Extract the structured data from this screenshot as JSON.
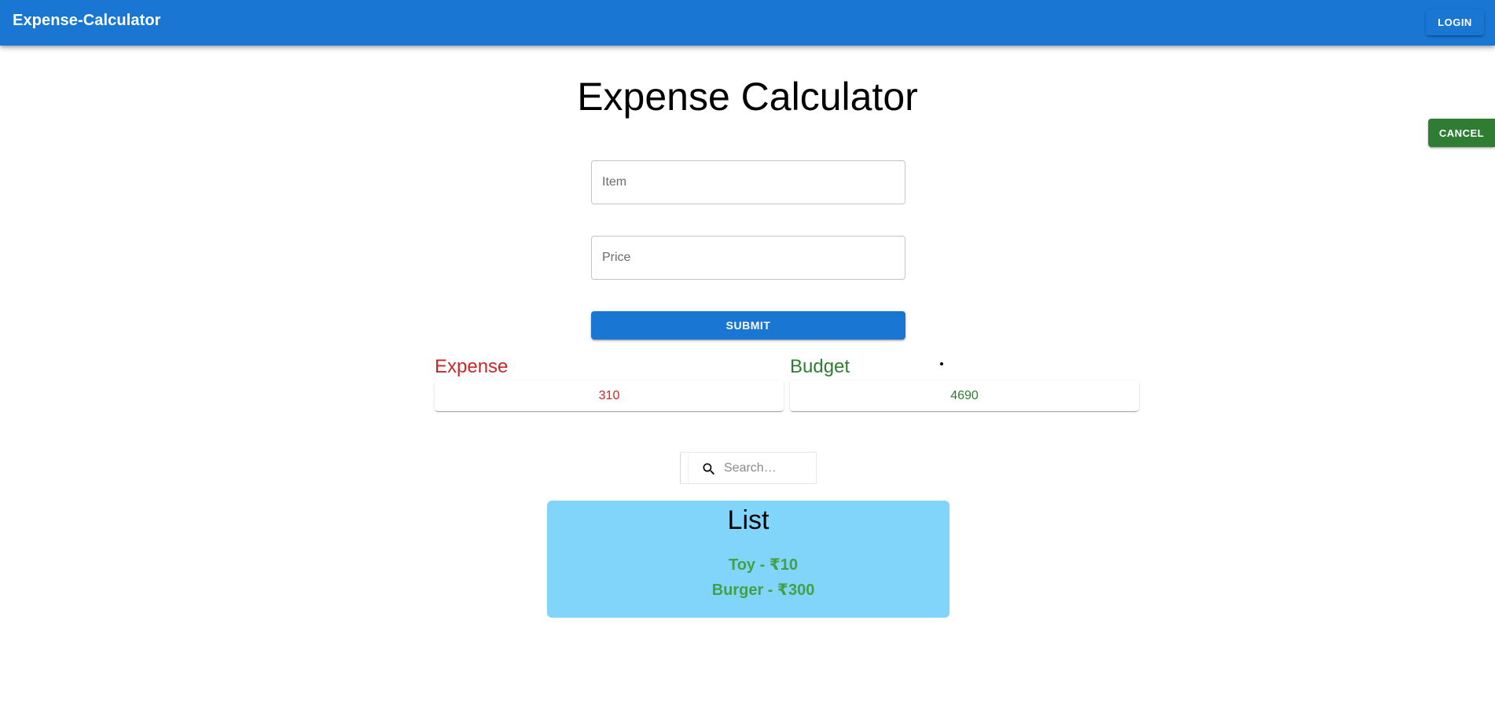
{
  "appbar": {
    "title": "Expense-Calculator",
    "login_label": "LOGIN",
    "color": "#1976d2"
  },
  "main": {
    "title": "Expense Calculator",
    "cancel_label": "CANCEL",
    "item_placeholder": "Item",
    "price_placeholder": "Price",
    "submit_label": "SUBMIT"
  },
  "stats": {
    "expense": {
      "label": "Expense",
      "value": "310",
      "color": "#c62828"
    },
    "budget": {
      "label": "Budget",
      "value": "4690",
      "color": "#2e7d32"
    }
  },
  "search": {
    "placeholder": "Search…",
    "icon": "search-icon"
  },
  "list": {
    "title": "List",
    "items": [
      {
        "text": "Toy - ₹10"
      },
      {
        "text": "Burger - ₹300"
      }
    ],
    "background": "#81d4fa",
    "item_color": "#43a047"
  }
}
